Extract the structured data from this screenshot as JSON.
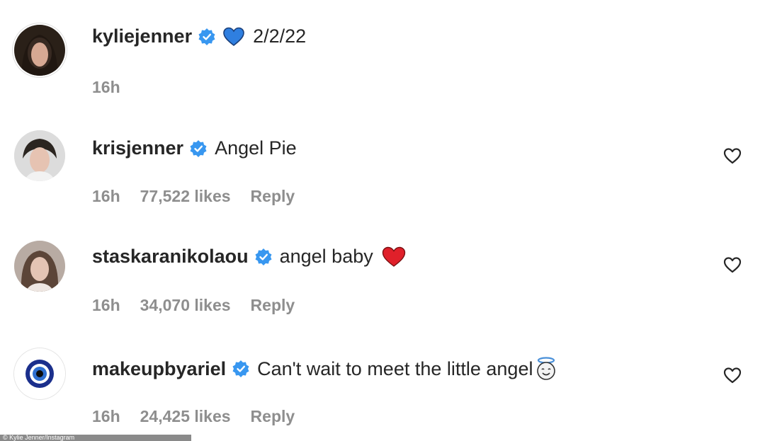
{
  "post": {
    "username": "kyliejenner",
    "caption_emoji": "blue-heart-emoji",
    "caption": "2/2/22",
    "time": "16h"
  },
  "comments": [
    {
      "username": "krisjenner",
      "text": "Angel Pie",
      "time": "16h",
      "likes": "77,522 likes",
      "reply": "Reply"
    },
    {
      "username": "staskaranikolaou",
      "text": "angel baby",
      "emoji": "red-heart-emoji",
      "time": "16h",
      "likes": "34,070 likes",
      "reply": "Reply"
    },
    {
      "username": "makeupbyariel",
      "text": "Can't wait to meet the little angel",
      "emoji": "angel-emoji",
      "time": "16h",
      "likes": "24,425 likes",
      "reply": "Reply"
    }
  ],
  "colors": {
    "verified": "#3897f0",
    "meta_text": "#8e8e8e",
    "primary_text": "#262626",
    "blue_heart": "#2f7fe0",
    "red_heart": "#e0202a"
  },
  "footer_credit": "© Kylie Jenner/Instagram"
}
